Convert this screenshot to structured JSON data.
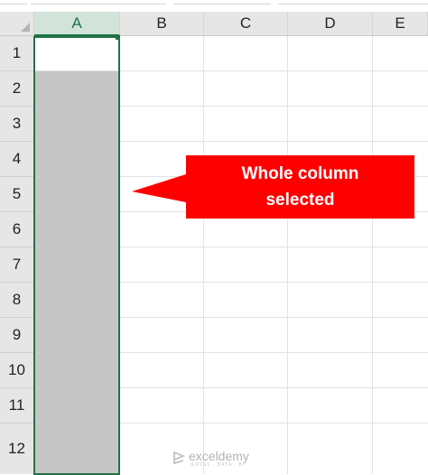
{
  "columns": [
    "A",
    "B",
    "C",
    "D",
    "E"
  ],
  "selected_column": "A",
  "rows": [
    "1",
    "2",
    "3",
    "4",
    "5",
    "6",
    "7",
    "8",
    "9",
    "10",
    "11",
    "12"
  ],
  "callout": {
    "line1": "Whole column",
    "line2": "selected",
    "color": "#ff0000"
  },
  "watermark": {
    "name": "exceldemy",
    "tagline": "EXCEL · DATA · BI"
  },
  "colors": {
    "selection_border": "#217346",
    "selection_fill": "#c6c6c6",
    "header_bg": "#e6e6e6"
  }
}
